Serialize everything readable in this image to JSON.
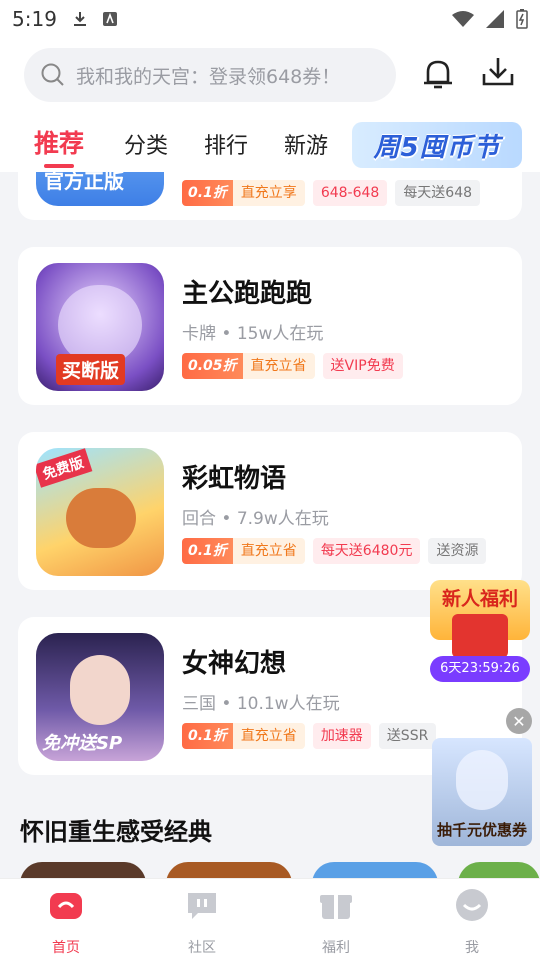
{
  "status_bar": {
    "time": "5:19"
  },
  "header": {
    "search_placeholder": "我和我的天宫：登录领648券！",
    "tabs": [
      "推荐",
      "分类",
      "排行",
      "新游"
    ],
    "banner_tab": "周5囤币节"
  },
  "cards": [
    {
      "name": "",
      "meta": "",
      "thumb_text": "官方正版",
      "discount": "0.1折",
      "discount_label": "直充立享",
      "tags": [
        "648-648",
        "每天送648"
      ]
    },
    {
      "name": "主公跑跑跑",
      "meta": "卡牌 • 15w人在玩",
      "thumb_text": "买断版",
      "discount": "0.05折",
      "discount_label": "直充立省",
      "tags": [
        "送VIP免费"
      ]
    },
    {
      "name": "彩虹物语",
      "meta": "回合 • 7.9w人在玩",
      "thumb_text": "免费版",
      "discount": "0.1折",
      "discount_label": "直充立省",
      "tags": [
        "每天送6480元",
        "送资源"
      ]
    },
    {
      "name": "女神幻想",
      "meta": "三国 • 10.1w人在玩",
      "thumb_text": "免冲送SP",
      "discount": "0.1折",
      "discount_label": "直充立省",
      "tags": [
        "加速器",
        "送SSR"
      ]
    }
  ],
  "section_title": "怀旧重生感受经典",
  "promo_newuser": {
    "title": "新人福利",
    "timer": "6天23:59:26"
  },
  "promo_coupon": {
    "text": "抽千元优惠券"
  },
  "bottom_nav": [
    {
      "label": "首页"
    },
    {
      "label": "社区"
    },
    {
      "label": "福利"
    },
    {
      "label": "我"
    }
  ],
  "colors": {
    "accent": "#f23b50",
    "discount": "#ff6b45"
  }
}
